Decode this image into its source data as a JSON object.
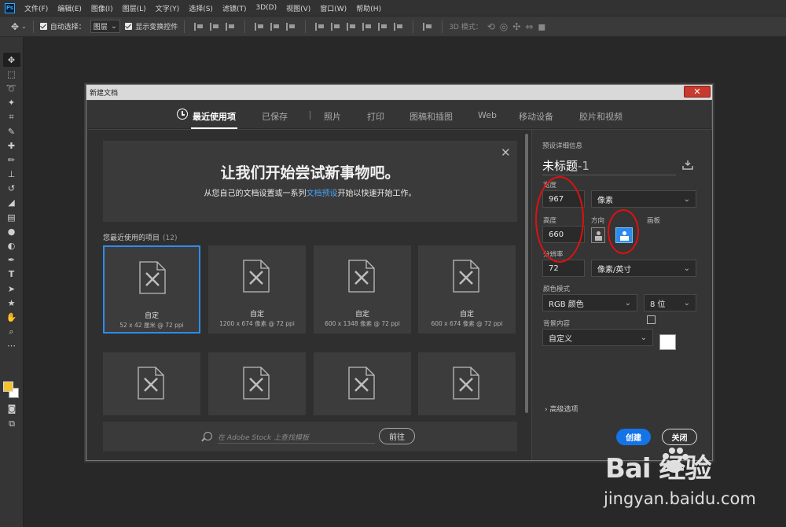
{
  "menubar": {
    "logo": "Ps",
    "items": [
      "文件(F)",
      "编辑(E)",
      "图像(I)",
      "图层(L)",
      "文字(Y)",
      "选择(S)",
      "滤镜(T)",
      "3D(D)",
      "视图(V)",
      "窗口(W)",
      "帮助(H)"
    ]
  },
  "options": {
    "auto_select_label": "自动选择：",
    "auto_select_value": "图层",
    "show_transform_label": "显示变换控件",
    "mode_3d_label": "3D 模式："
  },
  "dialog": {
    "title": "新建文档",
    "tabs": [
      "最近使用项",
      "已保存",
      "照片",
      "打印",
      "图稿和插图",
      "Web",
      "移动设备",
      "胶片和视频"
    ],
    "hero": {
      "title": "让我们开始尝试新事物吧。",
      "sub_pre": "从您自己的文档设置或一系列",
      "sub_link": "文档预设",
      "sub_post": "开始以快速开始工作。"
    },
    "recent": {
      "heading": "您最近使用的项目",
      "count": "(12)",
      "items": [
        {
          "name": "自定",
          "info": "52 x 42 厘米 @ 72 ppi"
        },
        {
          "name": "自定",
          "info": "1200 x 674 像素 @ 72 ppi"
        },
        {
          "name": "自定",
          "info": "600 x 1348 像素 @ 72 ppi"
        },
        {
          "name": "自定",
          "info": "600 x 674 像素 @ 72 ppi"
        }
      ]
    },
    "stock": {
      "placeholder": "在 Adobe Stock 上查找模板",
      "go": "前往"
    },
    "preset": {
      "heading": "预设详细信息",
      "name": "未标题",
      "name_suffix": "-1",
      "width_label": "宽度",
      "width": "967",
      "width_unit": "像素",
      "height_label": "高度",
      "height": "660",
      "orientation_label": "方向",
      "artboard_label": "画板",
      "resolution_label": "分辨率",
      "resolution": "72",
      "resolution_unit": "像素/英寸",
      "color_mode_label": "颜色模式",
      "color_mode": "RGB 颜色",
      "bit_depth": "8 位",
      "bg_label": "背景内容",
      "bg_value": "自定义",
      "advanced": "高级选项",
      "create": "创建",
      "close": "关闭"
    }
  },
  "watermark": {
    "logo": "Bai  经验",
    "url": "jingyan.baidu.com"
  },
  "colors": {
    "accent_blue": "#1473e6",
    "link_blue": "#4aa3f5",
    "annotation_red": "#e01010",
    "foreground_swatch": "#f2c230"
  }
}
